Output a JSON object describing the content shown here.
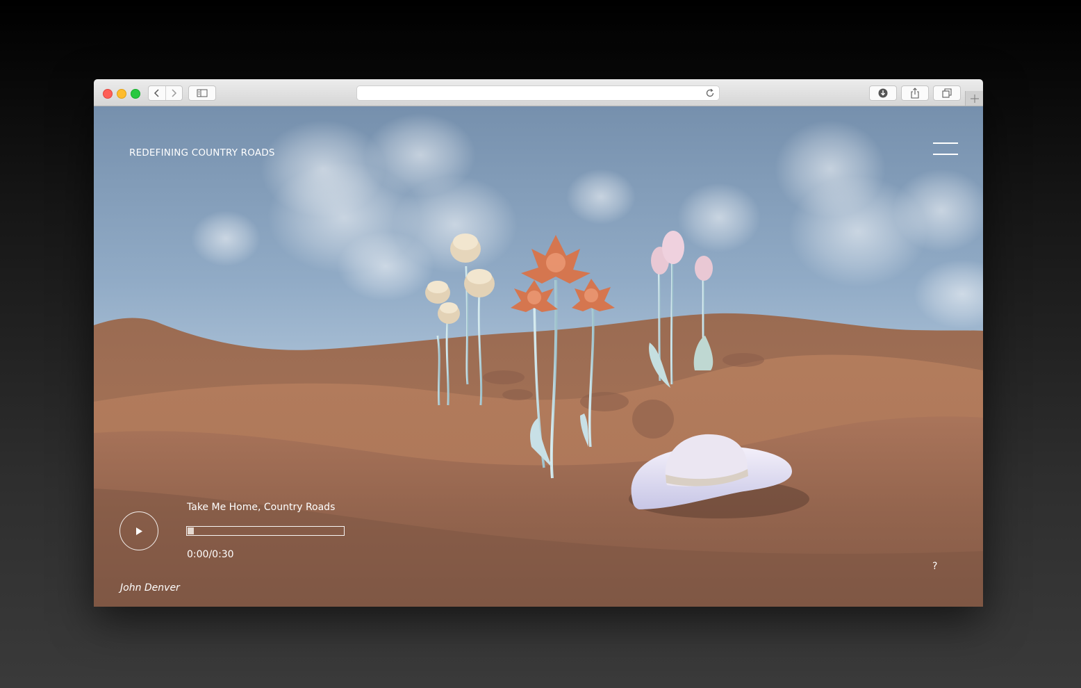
{
  "browser": {
    "url": "",
    "icons": {
      "back": "chevron-left-icon",
      "forward": "chevron-right-icon",
      "sidebar": "sidebar-icon",
      "reload": "reload-icon",
      "download": "download-icon",
      "share": "share-icon",
      "tabs": "tabs-icon",
      "new_tab": "plus-icon"
    }
  },
  "site": {
    "title": "REDEFINING COUNTRY ROADS",
    "menu_icon": "hamburger-menu-icon"
  },
  "player": {
    "song_title": "Take Me Home, Country Roads",
    "time": "0:00/0:30",
    "progress": 0.0,
    "play_icon": "play-icon"
  },
  "artist": "John Denver",
  "help_label": "?",
  "colors": {
    "sky_top": "#7b96b4",
    "sky_bottom": "#b8cde0",
    "sand": "#b07a5b",
    "sand_dark": "#7a5240",
    "text": "#ffffff"
  }
}
